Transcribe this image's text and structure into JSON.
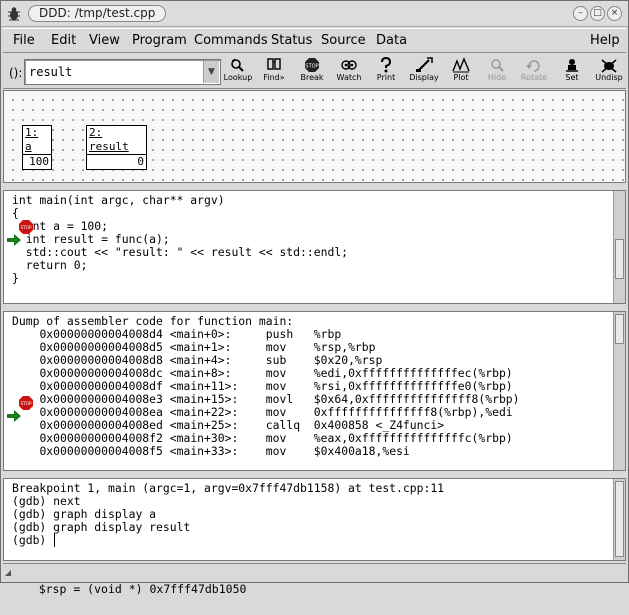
{
  "window": {
    "title": "DDD: /tmp/test.cpp"
  },
  "menubar": {
    "items": [
      "File",
      "Edit",
      "View",
      "Program",
      "Commands",
      "Status",
      "Source",
      "Data",
      "Help"
    ]
  },
  "toolbar": {
    "arg_label": "():",
    "arg_value": "result",
    "tools": [
      {
        "label": "Lookup",
        "icon": "lookup-icon",
        "enabled": true
      },
      {
        "label": "Find»",
        "icon": "find-icon",
        "enabled": true
      },
      {
        "label": "Break",
        "icon": "break-icon",
        "enabled": true
      },
      {
        "label": "Watch",
        "icon": "watch-icon",
        "enabled": true
      },
      {
        "label": "Print",
        "icon": "print-icon",
        "enabled": true
      },
      {
        "label": "Display",
        "icon": "display-icon",
        "enabled": true
      },
      {
        "label": "Plot",
        "icon": "plot-icon",
        "enabled": true
      },
      {
        "label": "Hide",
        "icon": "hide-icon",
        "enabled": false
      },
      {
        "label": "Rotate",
        "icon": "rotate-icon",
        "enabled": false
      },
      {
        "label": "Set",
        "icon": "set-icon",
        "enabled": true
      },
      {
        "label": "Undisp",
        "icon": "undisp-icon",
        "enabled": true
      }
    ]
  },
  "data_displays": [
    {
      "title": "1: a",
      "value": "100"
    },
    {
      "title": "2: result",
      "value": "0"
    }
  ],
  "source": {
    "lines": [
      "int main(int argc, char** argv)",
      "{",
      "  int a = 100;",
      "  int result = func(a);",
      "  std::cout << \"result: \" << result << std::endl;",
      "  return 0;",
      "}"
    ]
  },
  "assembler": {
    "header": "Dump of assembler code for function main:",
    "rows": [
      {
        "addr": "0x00000000004008d4",
        "off": "<main+0>:",
        "op": "push",
        "args": "%rbp"
      },
      {
        "addr": "0x00000000004008d5",
        "off": "<main+1>:",
        "op": "mov",
        "args": "%rsp,%rbp"
      },
      {
        "addr": "0x00000000004008d8",
        "off": "<main+4>:",
        "op": "sub",
        "args": "$0x20,%rsp"
      },
      {
        "addr": "0x00000000004008dc",
        "off": "<main+8>:",
        "op": "mov",
        "args": "%edi,0xffffffffffffffec(%rbp)"
      },
      {
        "addr": "0x00000000004008df",
        "off": "<main+11>:",
        "op": "mov",
        "args": "%rsi,0xffffffffffffffe0(%rbp)"
      },
      {
        "addr": "0x00000000004008e3",
        "off": "<main+15>:",
        "op": "movl",
        "args": "$0x64,0xfffffffffffffff8(%rbp)"
      },
      {
        "addr": "0x00000000004008ea",
        "off": "<main+22>:",
        "op": "mov",
        "args": "0xfffffffffffffff8(%rbp),%edi"
      },
      {
        "addr": "0x00000000004008ed",
        "off": "<main+25>:",
        "op": "callq",
        "args": "0x400858 <_Z4funci>"
      },
      {
        "addr": "0x00000000004008f2",
        "off": "<main+30>:",
        "op": "mov",
        "args": "%eax,0xfffffffffffffffc(%rbp)"
      },
      {
        "addr": "0x00000000004008f5",
        "off": "<main+33>:",
        "op": "mov",
        "args": "$0x400a18,%esi"
      }
    ]
  },
  "console": {
    "lines": [
      "Breakpoint 1, main (argc=1, argv=0x7fff47db1158) at test.cpp:11",
      "(gdb) next",
      "(gdb) graph display a",
      "(gdb) graph display result",
      "(gdb) "
    ]
  },
  "status": {
    "text": "$rsp = (void *) 0x7fff47db1050"
  },
  "colors": {
    "stop_red": "#cc1111",
    "arrow_green": "#1a7a1a"
  }
}
